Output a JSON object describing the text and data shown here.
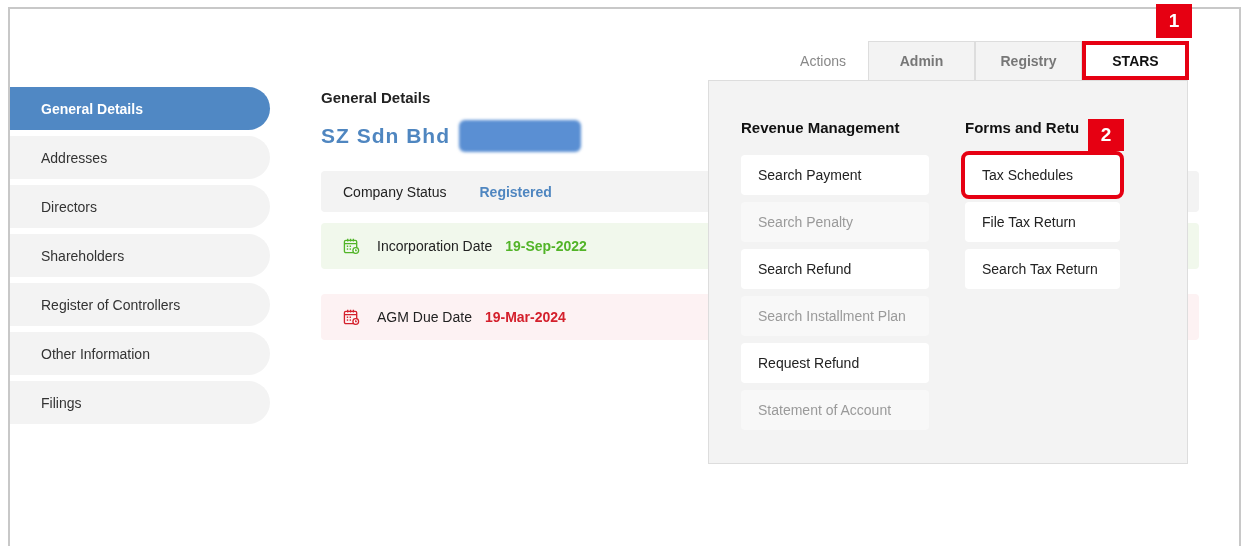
{
  "sidebar": {
    "items": [
      {
        "label": "General Details",
        "selected": true
      },
      {
        "label": "Addresses",
        "selected": false
      },
      {
        "label": "Directors",
        "selected": false
      },
      {
        "label": "Shareholders",
        "selected": false
      },
      {
        "label": "Register of Controllers",
        "selected": false
      },
      {
        "label": "Other Information",
        "selected": false
      },
      {
        "label": "Filings",
        "selected": false
      }
    ]
  },
  "main": {
    "title": "General Details",
    "company_name": "SZ Sdn Bhd",
    "registration_redacted": true,
    "status": {
      "label": "Company Status",
      "value": "Registered"
    },
    "dates": [
      {
        "kind": "ok",
        "label": "Incorporation Date",
        "value": "19-Sep-2022"
      },
      {
        "kind": "due",
        "label": "AGM Due Date",
        "value": "19-Mar-2024"
      }
    ]
  },
  "tabs": [
    {
      "label": "Actions",
      "selected": false,
      "kind": "plain"
    },
    {
      "label": "Admin",
      "selected": false,
      "kind": "boxed"
    },
    {
      "label": "Registry",
      "selected": false,
      "kind": "boxed"
    },
    {
      "label": "STARS",
      "selected": true,
      "kind": "boxed",
      "callout": "1"
    }
  ],
  "menu": {
    "columns": [
      {
        "heading": "Revenue Management",
        "items": [
          {
            "label": "Search Payment",
            "disabled": false
          },
          {
            "label": "Search Penalty",
            "disabled": true
          },
          {
            "label": "Search Refund",
            "disabled": false
          },
          {
            "label": "Search Installment Plan",
            "disabled": true
          },
          {
            "label": "Request Refund",
            "disabled": false
          },
          {
            "label": "Statement of Account",
            "disabled": true
          }
        ]
      },
      {
        "heading": "Forms and Retu",
        "items": [
          {
            "label": "Tax Schedules",
            "disabled": false,
            "callout": "2"
          },
          {
            "label": "File Tax Return",
            "disabled": false
          },
          {
            "label": "Search Tax Return",
            "disabled": false
          }
        ]
      }
    ]
  }
}
